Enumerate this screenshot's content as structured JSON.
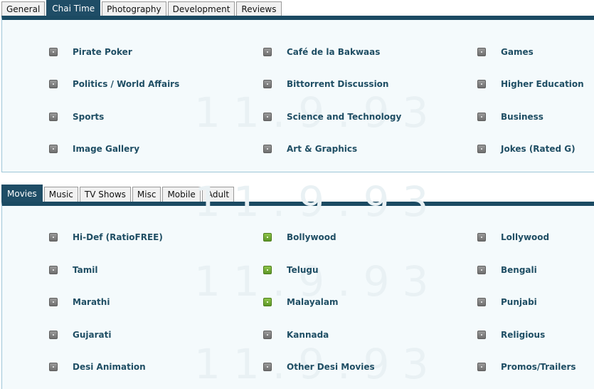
{
  "top_tabs": {
    "items": [
      {
        "label": "General"
      },
      {
        "label": "Chai Time",
        "active": true
      },
      {
        "label": "Photography"
      },
      {
        "label": "Development"
      },
      {
        "label": "Reviews"
      }
    ]
  },
  "top_forums": {
    "items": [
      {
        "label": "Pirate Poker"
      },
      {
        "label": "Café de la Bakwaas"
      },
      {
        "label": "Games"
      },
      {
        "label": "Politics / World Affairs"
      },
      {
        "label": "Bittorrent Discussion"
      },
      {
        "label": "Higher Education"
      },
      {
        "label": "Sports"
      },
      {
        "label": "Science and Technology"
      },
      {
        "label": "Business"
      },
      {
        "label": "Image Gallery"
      },
      {
        "label": "Art & Graphics"
      },
      {
        "label": "Jokes (Rated G)"
      }
    ]
  },
  "bottom_tabs": {
    "items": [
      {
        "label": "Movies",
        "active": true
      },
      {
        "label": "Music"
      },
      {
        "label": "TV Shows"
      },
      {
        "label": "Misc"
      },
      {
        "label": "Mobile"
      },
      {
        "label": "Adult"
      }
    ]
  },
  "bottom_forums": {
    "items": [
      {
        "label": "Hi-Def (RatioFREE)",
        "status": "no-new"
      },
      {
        "label": "Bollywood",
        "status": "new"
      },
      {
        "label": "Lollywood",
        "status": "no-new"
      },
      {
        "label": "Tamil",
        "status": "no-new"
      },
      {
        "label": "Telugu",
        "status": "new"
      },
      {
        "label": "Bengali",
        "status": "no-new"
      },
      {
        "label": "Marathi",
        "status": "no-new"
      },
      {
        "label": "Malayalam",
        "status": "new"
      },
      {
        "label": "Punjabi",
        "status": "no-new"
      },
      {
        "label": "Gujarati",
        "status": "no-new"
      },
      {
        "label": "Kannada",
        "status": "no-new"
      },
      {
        "label": "Religious",
        "status": "no-new"
      },
      {
        "label": "Desi Animation",
        "status": "no-new"
      },
      {
        "label": "Other Desi Movies",
        "status": "no-new"
      },
      {
        "label": "Promos/Trailers",
        "status": "no-new"
      }
    ]
  },
  "colors": {
    "accent": "#1f4d66",
    "link": "#1f4e64",
    "panel_bg": "#f4fafc",
    "bullet_grey": "#7f7f7f",
    "bullet_green": "#6fa838"
  }
}
